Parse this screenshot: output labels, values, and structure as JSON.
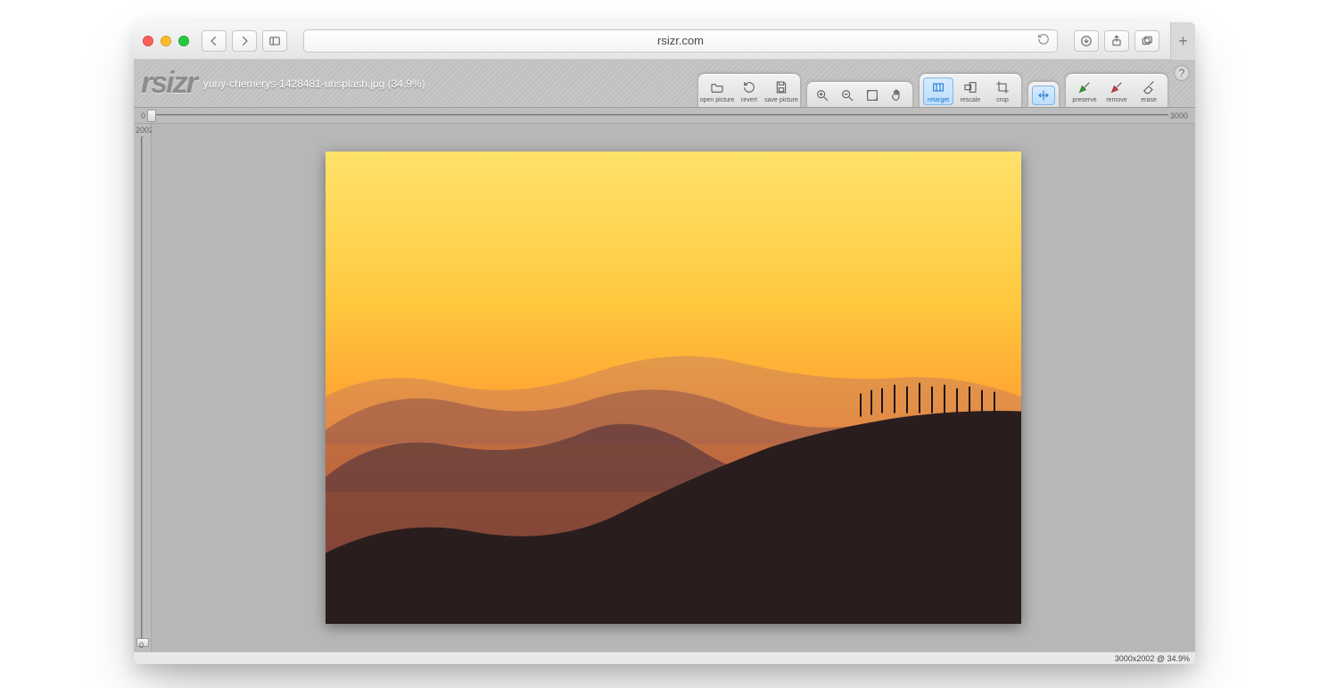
{
  "browser": {
    "url": "rsizr.com"
  },
  "app": {
    "logo_text": "rsizr",
    "filename": "yuriy-chemerys-1428481-unsplash.jpg (34.9%)",
    "help_label": "?"
  },
  "ruler": {
    "h_min": "0",
    "h_max": "3000",
    "v_top": "2002",
    "v_bottom": "0"
  },
  "tools": {
    "file": {
      "open": "open picture",
      "revert": "revert",
      "save": "save picture"
    },
    "resize": {
      "retarget": "retarget",
      "rescale": "rescale",
      "crop": "crop"
    },
    "brush": {
      "preserve": "preserve",
      "remove": "remove",
      "erase": "erase"
    }
  },
  "status": {
    "text": "3000x2002 @ 34.9%"
  }
}
